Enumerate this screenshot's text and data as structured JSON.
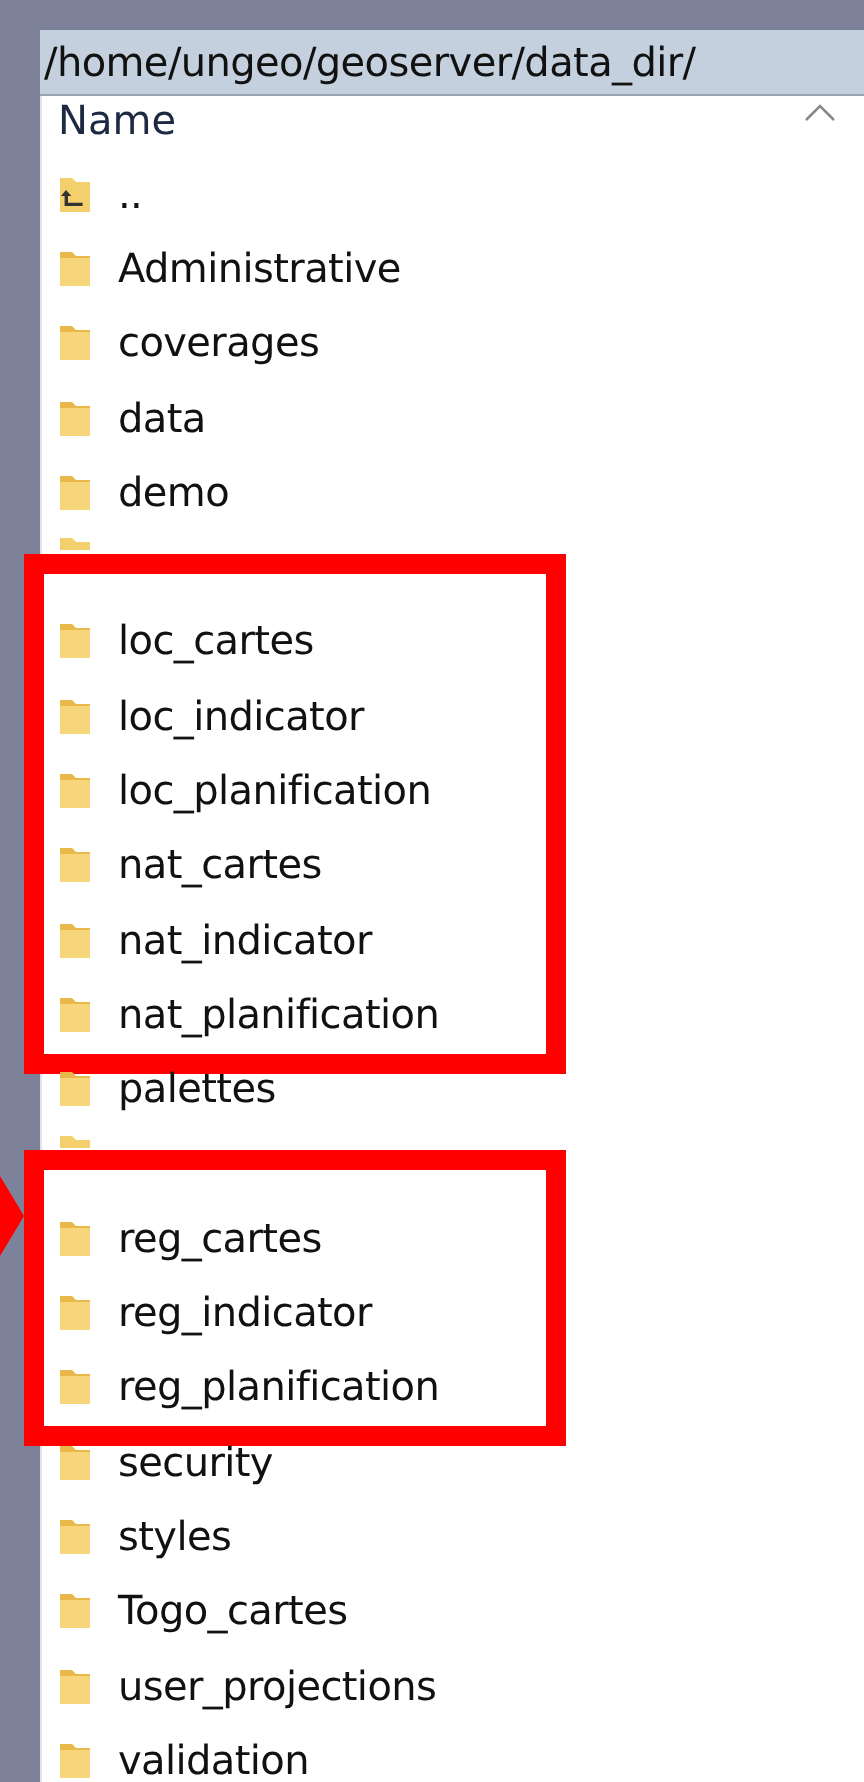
{
  "path": "/home/ungeo/geoserver/data_dir/",
  "column": {
    "label": "Name"
  },
  "sections": [
    {
      "highlighted": false,
      "rows": [
        {
          "name": "..",
          "kind": "parent"
        },
        {
          "name": "Administrative",
          "kind": "folder"
        },
        {
          "name": "coverages",
          "kind": "folder"
        },
        {
          "name": "data",
          "kind": "folder"
        },
        {
          "name": "demo",
          "kind": "folder"
        },
        {
          "kind": "covered"
        }
      ]
    },
    {
      "highlighted": true,
      "rows": [
        {
          "name": "loc_cartes",
          "kind": "folder"
        },
        {
          "name": "loc_indicator",
          "kind": "folder"
        },
        {
          "name": "loc_planification",
          "kind": "folder"
        },
        {
          "name": "nat_cartes",
          "kind": "folder"
        },
        {
          "name": "nat_indicator",
          "kind": "folder"
        },
        {
          "name": "nat_planification",
          "kind": "folder"
        }
      ]
    },
    {
      "highlighted": false,
      "rows": [
        {
          "name": "palettes",
          "kind": "folder"
        },
        {
          "kind": "covered"
        }
      ]
    },
    {
      "highlighted": true,
      "pointer": true,
      "rows": [
        {
          "name": "reg_cartes",
          "kind": "folder"
        },
        {
          "name": "reg_indicator",
          "kind": "folder"
        },
        {
          "name": "reg_planification",
          "kind": "folder"
        }
      ]
    },
    {
      "highlighted": false,
      "rows": [
        {
          "name": "security",
          "kind": "folder"
        },
        {
          "name": "styles",
          "kind": "folder"
        },
        {
          "name": "Togo_cartes",
          "kind": "folder"
        },
        {
          "name": "user_projections",
          "kind": "folder"
        },
        {
          "name": "validation",
          "kind": "folder"
        }
      ]
    }
  ]
}
